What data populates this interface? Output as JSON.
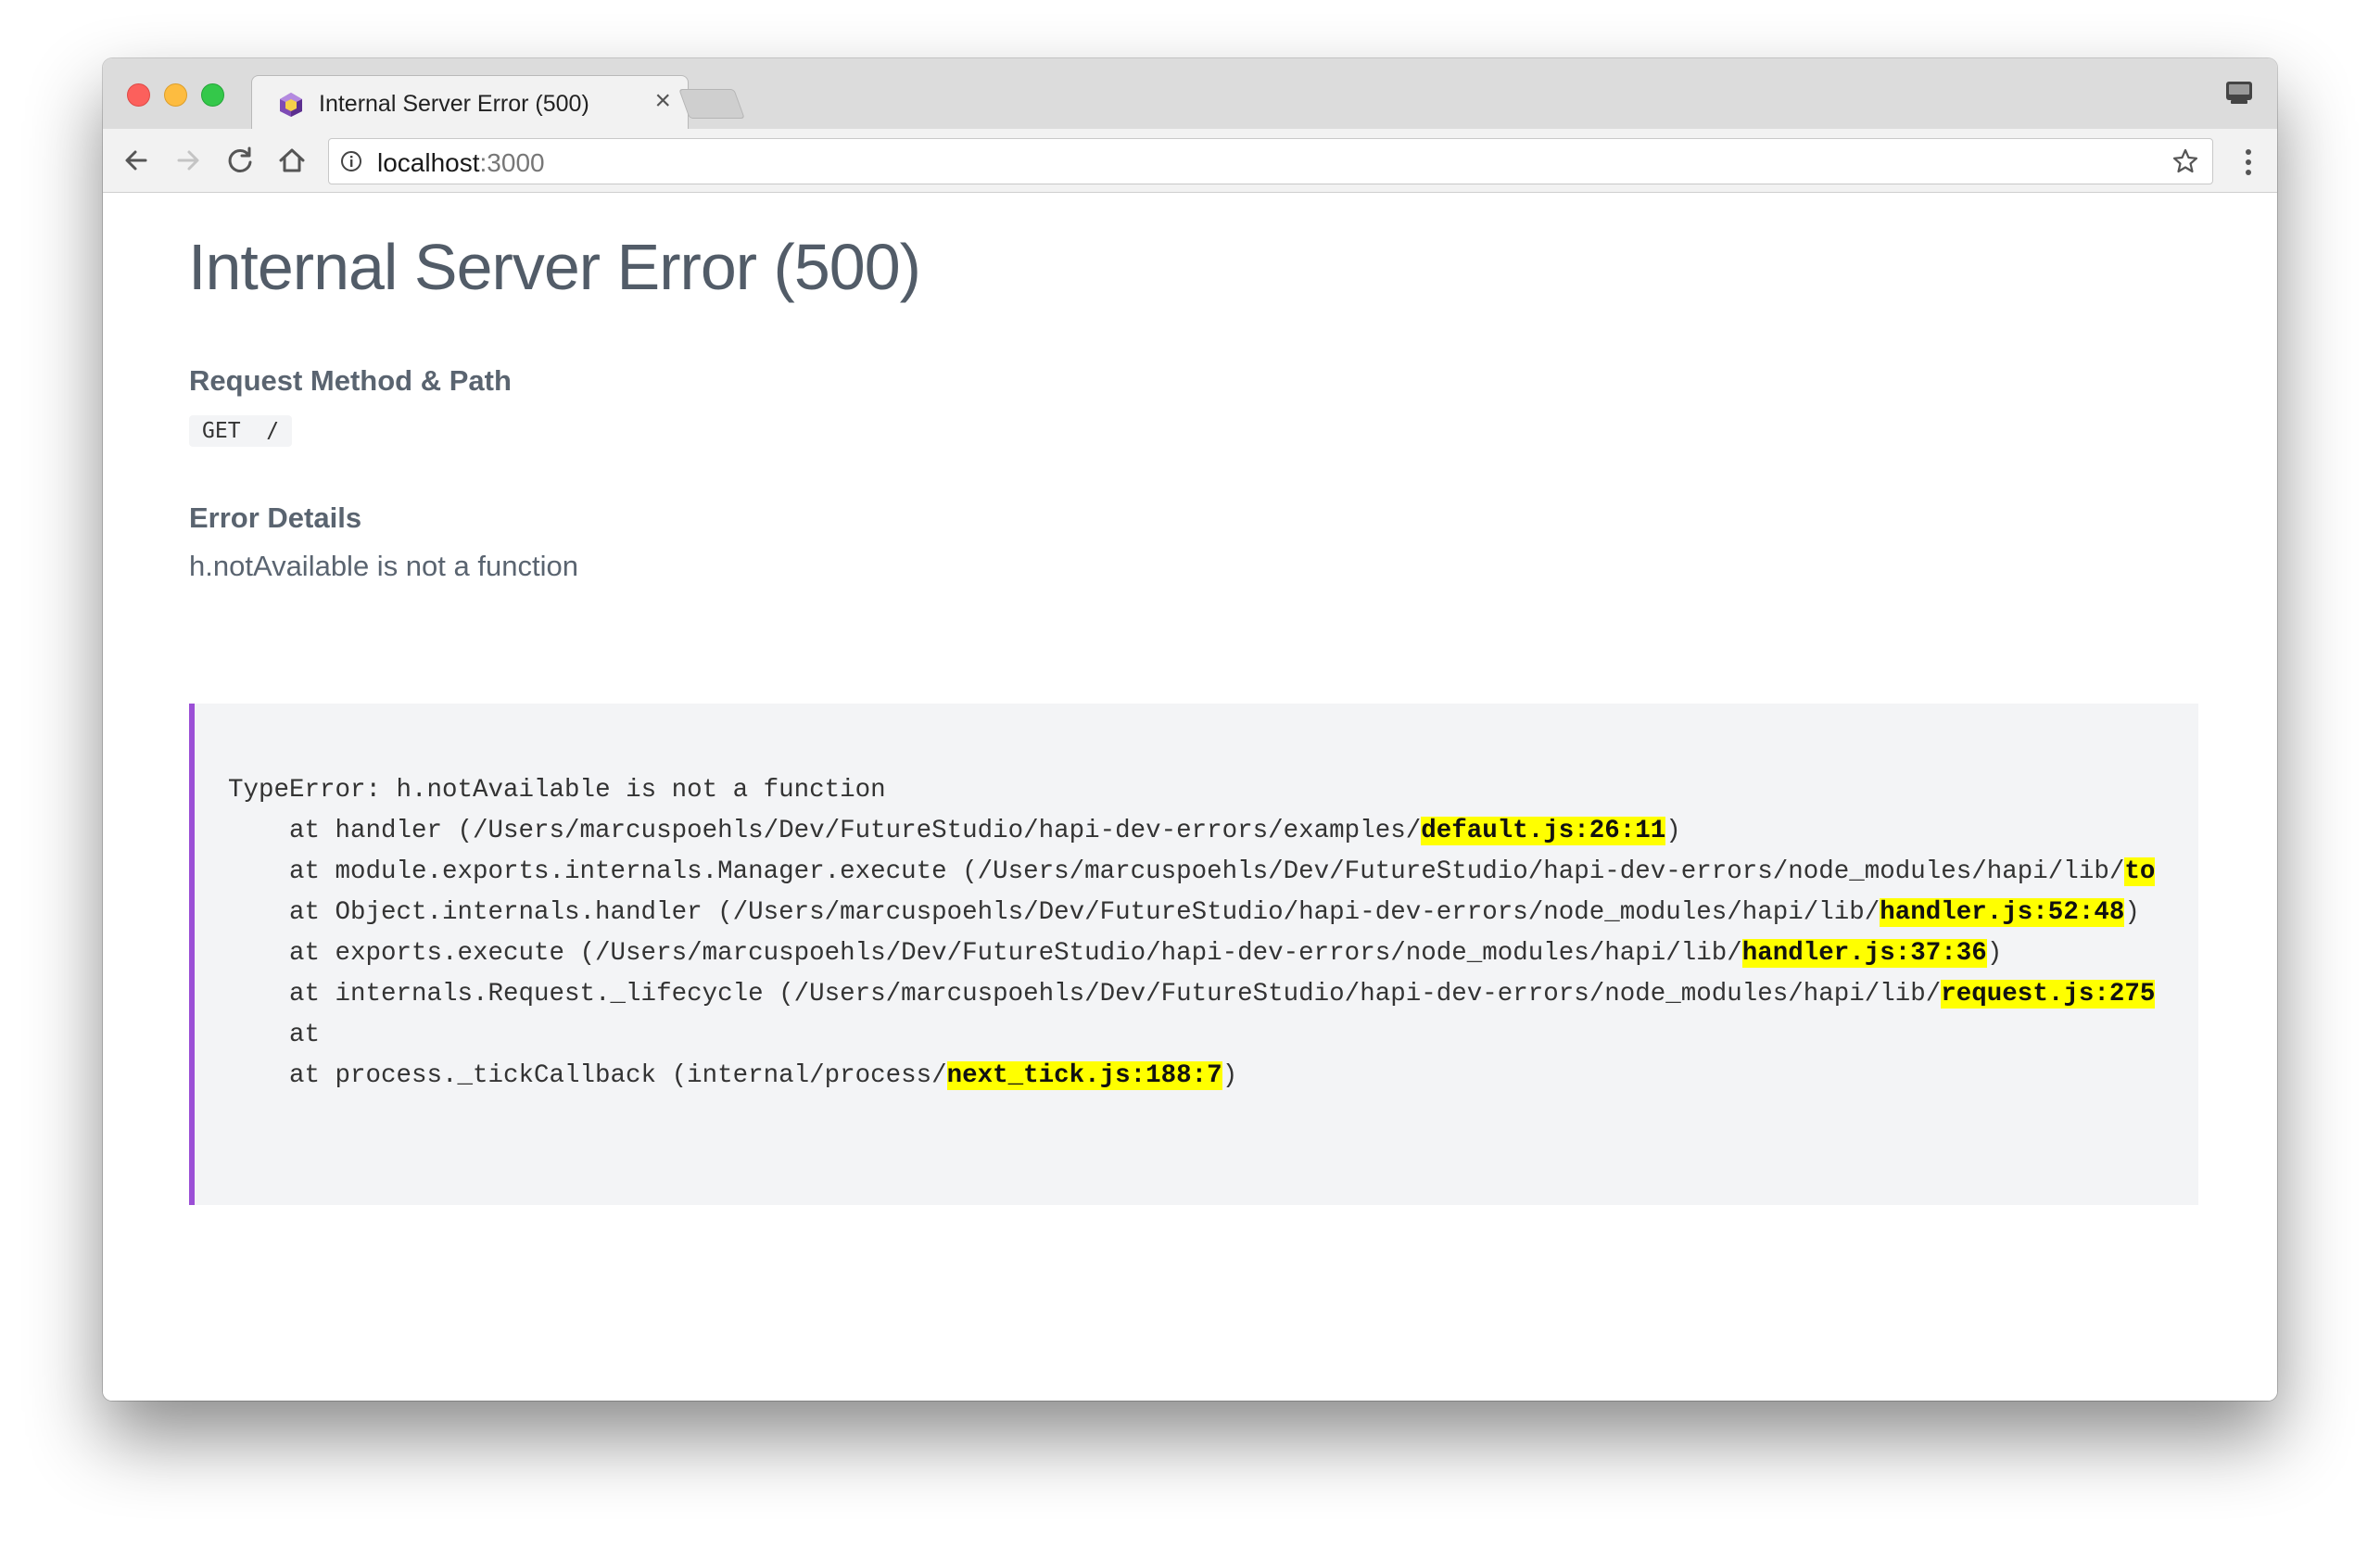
{
  "browser": {
    "tab": {
      "title": "Internal Server Error (500)",
      "close_glyph": "×"
    },
    "toolbar": {
      "back_icon": "arrow-left-icon",
      "forward_icon": "arrow-right-icon",
      "reload_icon": "reload-icon",
      "home_icon": "home-icon"
    },
    "omnibox": {
      "host": "localhost",
      "port": ":3000"
    }
  },
  "page": {
    "title": "Internal Server Error (500)",
    "request_heading": "Request Method & Path",
    "method_path": "GET  /",
    "error_heading": "Error Details",
    "error_message": "h.notAvailable is not a function",
    "stack_accent_color": "#9b4fd6",
    "highlight_color": "#ffff00",
    "stack": [
      {
        "prefix": "TypeError: h.notAvailable is not a function",
        "highlight": "",
        "suffix": "",
        "indent": false
      },
      {
        "prefix": "at handler (/Users/marcuspoehls/Dev/FutureStudio/hapi-dev-errors/examples/",
        "highlight": "default.js:26:11",
        "suffix": ")",
        "indent": true
      },
      {
        "prefix": "at module.exports.internals.Manager.execute (/Users/marcuspoehls/Dev/FutureStudio/hapi-dev-errors/node_modules/hapi/lib/",
        "highlight": "to",
        "suffix": "",
        "indent": true
      },
      {
        "prefix": "at Object.internals.handler (/Users/marcuspoehls/Dev/FutureStudio/hapi-dev-errors/node_modules/hapi/lib/",
        "highlight": "handler.js:52:48",
        "suffix": ")",
        "indent": true
      },
      {
        "prefix": "at exports.execute (/Users/marcuspoehls/Dev/FutureStudio/hapi-dev-errors/node_modules/hapi/lib/",
        "highlight": "handler.js:37:36",
        "suffix": ")",
        "indent": true
      },
      {
        "prefix": "at internals.Request._lifecycle (/Users/marcuspoehls/Dev/FutureStudio/hapi-dev-errors/node_modules/hapi/lib/",
        "highlight": "request.js:275",
        "suffix": "",
        "indent": true
      },
      {
        "prefix": "at",
        "highlight": "",
        "suffix": "",
        "indent": true
      },
      {
        "prefix": "at process._tickCallback (internal/process/",
        "highlight": "next_tick.js:188:7",
        "suffix": ")",
        "indent": true
      }
    ]
  }
}
